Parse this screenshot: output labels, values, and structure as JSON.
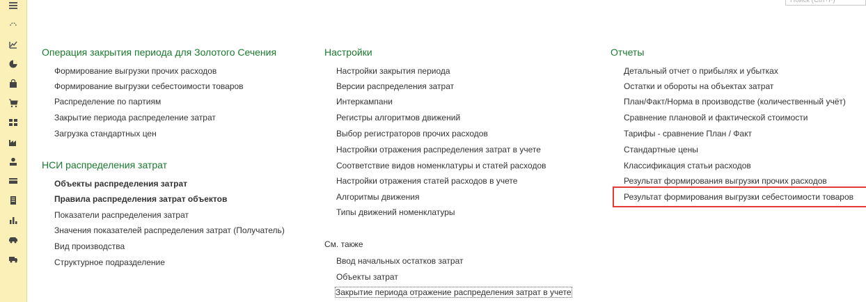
{
  "search": {
    "placeholder": "Поиск (Ctrl+F)"
  },
  "sidebar": {
    "icons": [
      "menu-icon",
      "history-icon",
      "chart-icon",
      "pie-chart-icon",
      "bag-icon",
      "cart-icon",
      "grid-icon",
      "factory-icon",
      "person-icon",
      "card-icon",
      "document-icon",
      "bar-chart-icon",
      "car-icon",
      "truck-icon"
    ]
  },
  "column1": {
    "section1": {
      "title": "Операция закрытия периода для Золотого Сечения",
      "items": [
        "Формирование выгрузки прочих расходов",
        "Формирование выгрузки себестоимости товаров",
        "Распределение по партиям",
        "Закрытие периода распределение затрат",
        "Загрузка стандартных цен"
      ]
    },
    "section2": {
      "title": "НСИ распределения затрат",
      "items": [
        "Объекты распределения затрат",
        "Правила распределения затрат объектов",
        "Показатели распределения затрат",
        "Значения показателей распределения затрат (Получатель)",
        "Вид производства",
        "Структурное подразделение"
      ]
    }
  },
  "column2": {
    "section1": {
      "title": "Настройки",
      "items": [
        "Настройки закрытия периода",
        "Версии распределения затрат",
        "Интеркампани",
        "Регистры алгоритмов движений",
        "Выбор регистраторов прочих расходов",
        "Настройки отражения распределения затрат в учете",
        "Соответствие видов номенклатуры и статей расходов",
        "Настройки отражения статей расходов в учете",
        "Алгоритмы движения",
        "Типы движений номенклатуры"
      ]
    },
    "see_also": {
      "title": "См. также",
      "items": [
        "Ввод начальных остатков затрат",
        "Объекты затрат",
        "Закрытие периода отражение распределения затрат в учете"
      ]
    }
  },
  "column3": {
    "section1": {
      "title": "Отчеты",
      "items": [
        "Детальный отчет о прибылях и убытках",
        "Остатки и обороты на объектах затрат",
        "План/Факт/Норма в производстве (количественный учёт)",
        "Сравнение плановой и фактической стоимости",
        "Тарифы - сравнение План / Факт",
        "Стандартные цены",
        "Классификация статьи расходов",
        "Результат формирования выгрузки прочих расходов",
        "Результат формирования выгрузки себестоимости товаров"
      ]
    }
  }
}
